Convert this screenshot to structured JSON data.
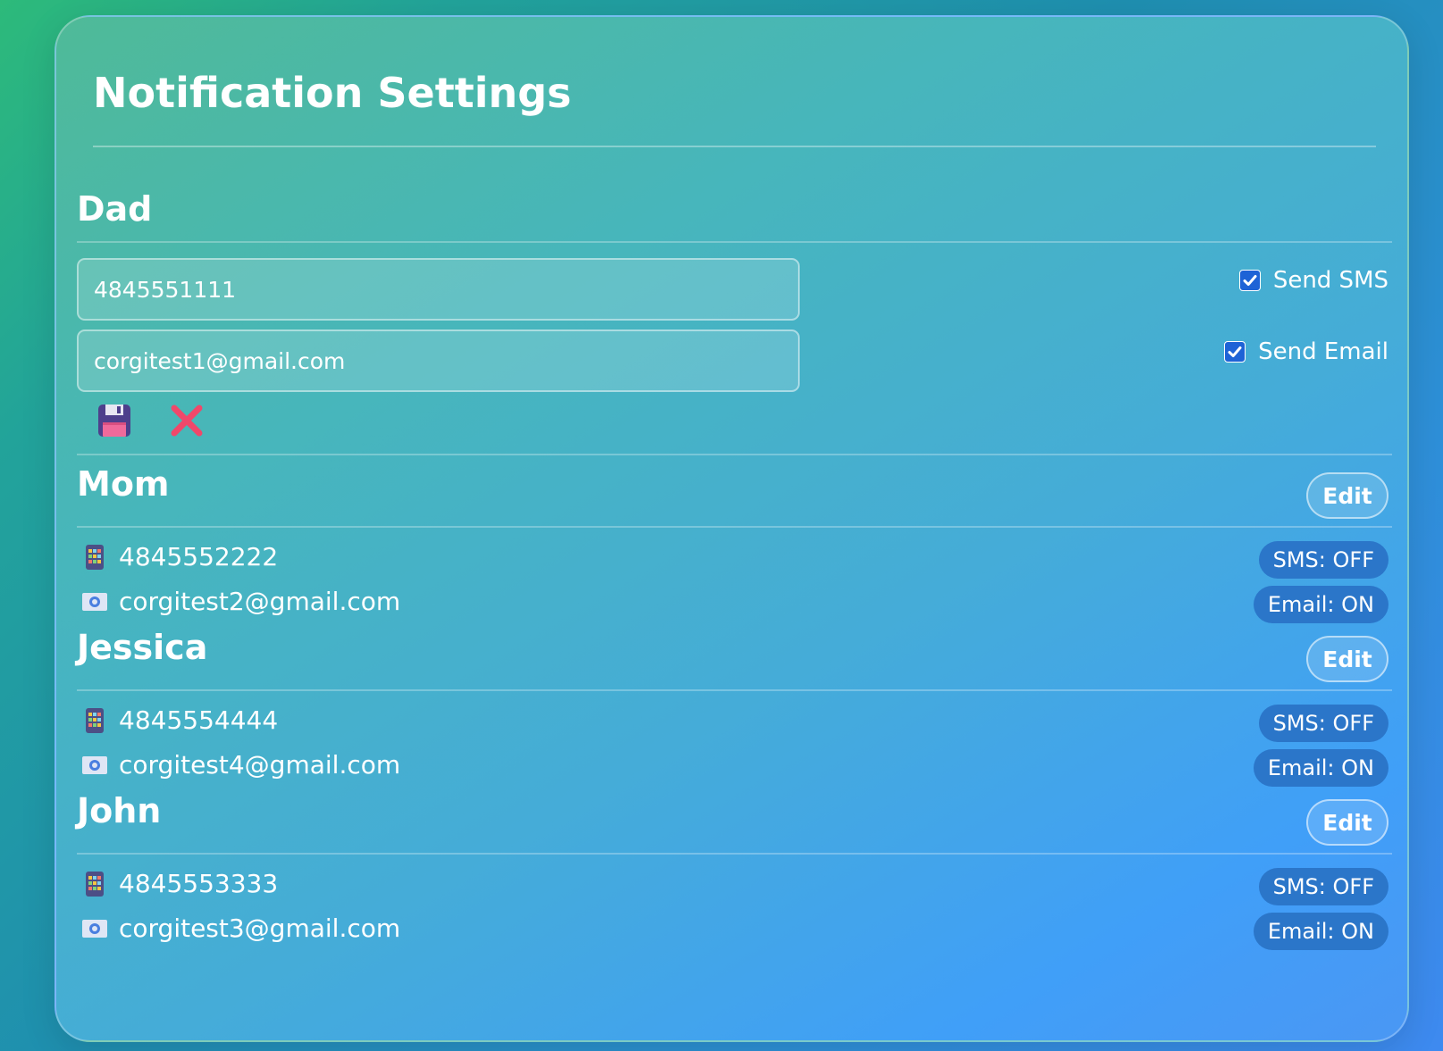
{
  "page": {
    "title": "Notification Settings"
  },
  "editing_contact": {
    "name": "Dad",
    "phone_value": "4845551111",
    "email_value": "corgitest1@gmail.com",
    "send_sms_label": "Send SMS",
    "send_sms_checked": true,
    "send_email_label": "Send Email",
    "send_email_checked": true,
    "save_icon": "floppy-disk-icon",
    "cancel_icon": "cross-mark-icon"
  },
  "contacts": [
    {
      "name": "Mom",
      "edit_label": "Edit",
      "phone": "4845552222",
      "email": "corgitest2@gmail.com",
      "sms_status": "SMS: OFF",
      "email_status": "Email: ON"
    },
    {
      "name": "Jessica",
      "edit_label": "Edit",
      "phone": "4845554444",
      "email": "corgitest4@gmail.com",
      "sms_status": "SMS: OFF",
      "email_status": "Email: ON"
    },
    {
      "name": "John",
      "edit_label": "Edit",
      "phone": "4845553333",
      "email": "corgitest3@gmail.com",
      "sms_status": "SMS: OFF",
      "email_status": "Email: ON"
    }
  ],
  "icons": {
    "phone": "mobile-phone-icon",
    "email": "email-icon"
  },
  "colors": {
    "badge_bg": "#2b76c9",
    "checkbox_bg": "#1e63d6",
    "cancel_red": "#f0486a",
    "save_purple": "#4e3f8c"
  }
}
